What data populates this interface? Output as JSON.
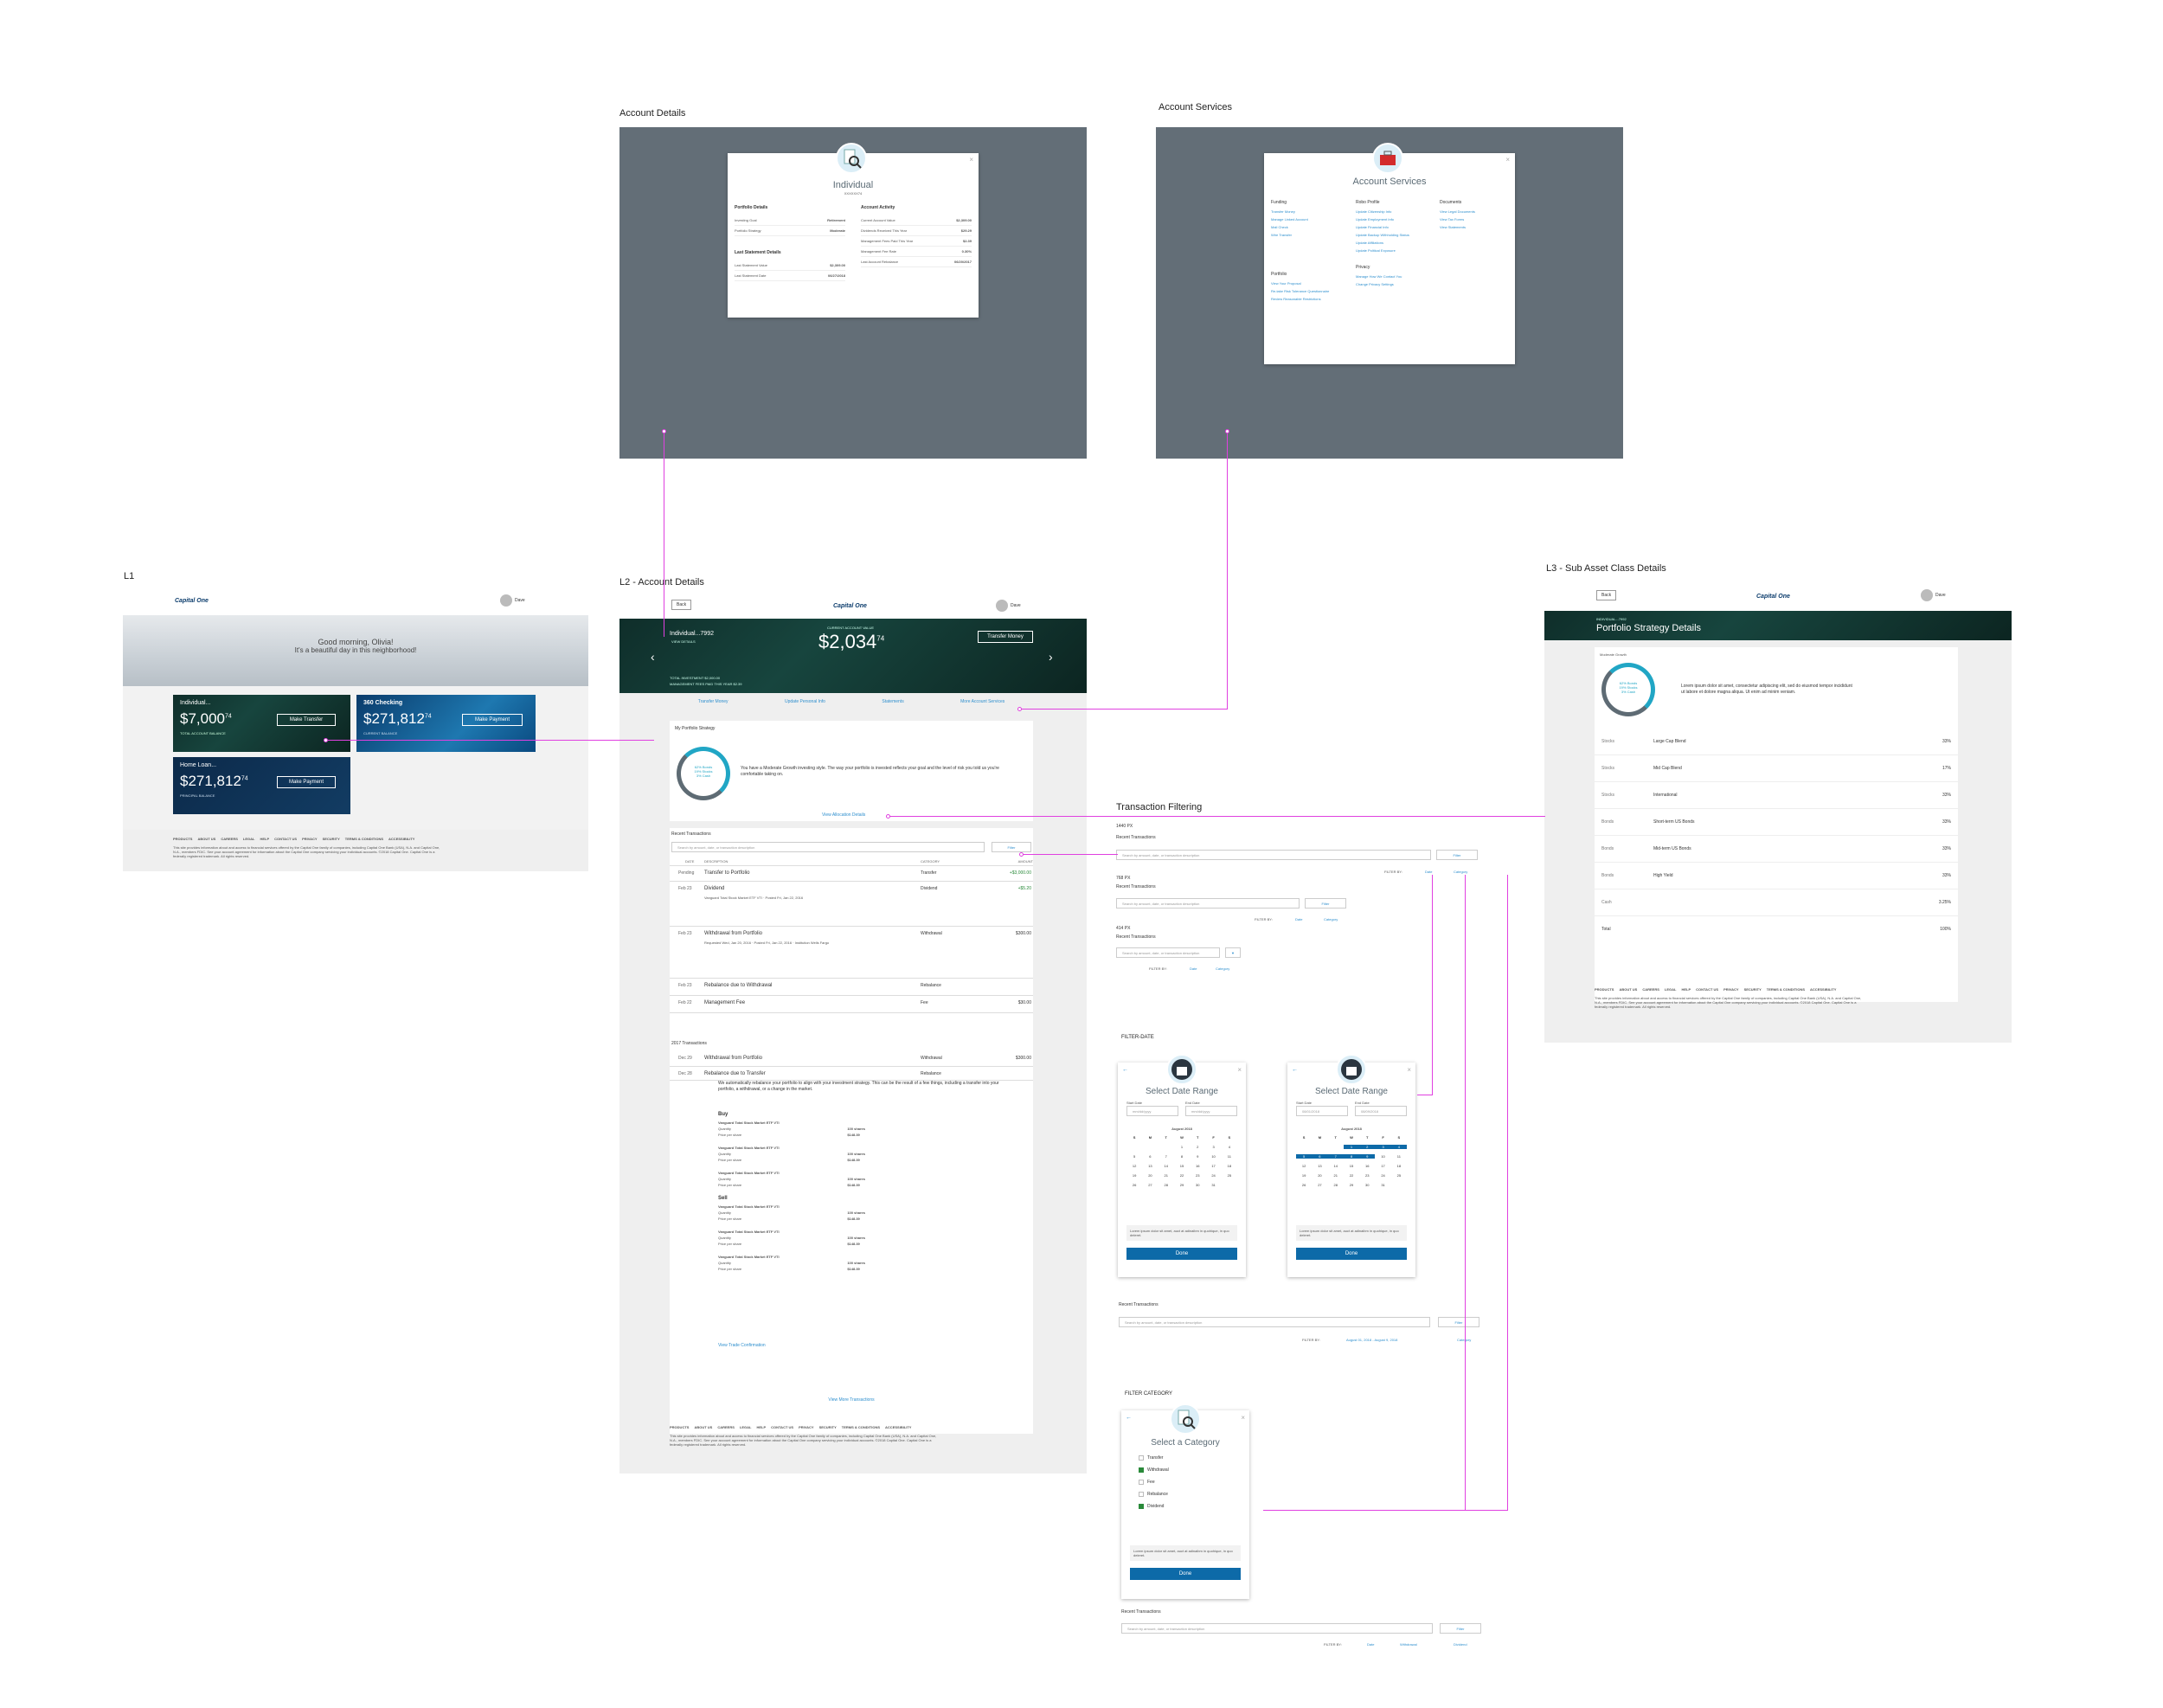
{
  "sections": {
    "account_details": "Account Details",
    "account_services": "Account Services",
    "l1": "L1",
    "l2": "L2 - Account Details",
    "l3": "L3 - Sub Asset Class Details",
    "transaction_filtering": "Transaction Filtering",
    "filter_date": "FILTER-DATE",
    "filter_category": "FILTER CATEGORY"
  },
  "details_modal": {
    "title": "Individual",
    "sub": "XXXXXX74",
    "portfolio_h": "Portfolio Details",
    "portfolio_rows": [
      [
        "Investing Goal",
        "Retirement"
      ],
      [
        "Portfolio Strategy",
        "Moderate"
      ]
    ],
    "statement_h": "Last Statement Details",
    "statement_rows": [
      [
        "Last Statement Value",
        "$2,309.00"
      ],
      [
        "Last Statement Date",
        "06/27/2018"
      ]
    ],
    "activity_h": "Account Activity",
    "activity_rows": [
      [
        "Current Account Value",
        "$2,309.00"
      ],
      [
        "Dividends Received This Year",
        "$29.29"
      ],
      [
        "Management Fees Paid This Year",
        "$2.39"
      ],
      [
        "Management Fee Rate",
        "0.30%"
      ],
      [
        "Last Account Rebalance",
        "06/20/2017"
      ]
    ]
  },
  "services_modal": {
    "title": "Account Services",
    "funding_h": "Funding",
    "funding": [
      "Transfer Money",
      "Manage Linked Account",
      "Mail Check",
      "Wire Transfer"
    ],
    "robo_h": "Robo Profile",
    "robo": [
      "Update Citizenship Info",
      "Update Employment Info",
      "Update Financial Info",
      "Update Backup Withholding Status",
      "Update Affiliations",
      "Update Political Exposure"
    ],
    "docs_h": "Documents",
    "docs": [
      "View Legal Documents",
      "View Tax Forms",
      "View Statements"
    ],
    "portfolio_h": "Portfolio",
    "portfolio": [
      "View Your Proposal",
      "Re-take Risk Tolerance Questionnaire",
      "Review Reasonable Restrictions"
    ],
    "privacy_h": "Privacy",
    "privacy": [
      "Manage How We Contact You",
      "Change Privacy Settings"
    ]
  },
  "header": {
    "logo": "Capital One",
    "user": "Dave",
    "back": "Back"
  },
  "l1": {
    "greeting": "Good morning, Olivia!",
    "subgreeting": "It's a beautiful day in this neighborhood!",
    "cards": [
      {
        "name": "Individual...",
        "sub": "7992",
        "dollars": "$7,000",
        "cents": "74",
        "caption": "TOTAL ACCOUNT BALANCE",
        "action": "Make Transfer"
      },
      {
        "name": "360 Checking",
        "sub": "...7560",
        "dollars": "$271,812",
        "cents": "74",
        "caption": "CURRENT BALANCE",
        "action": "Make Payment"
      },
      {
        "name": "Home Loan...",
        "sub": "9992",
        "dollars": "$271,812",
        "cents": "74",
        "caption": "PRINCIPAL BALANCE",
        "action": "Make Payment"
      }
    ]
  },
  "l2": {
    "acct_name": "Individual...7992",
    "view_details": "VIEW DETAILS",
    "value_label": "CURRENT ACCOUNT VALUE",
    "value": "$2,034",
    "value_cents": "74",
    "transfer": "Transfer Money",
    "total_inv": "TOTAL INVESTMENT  $2,000.00",
    "mgmt_fees": "MANAGEMENT FEES PAID THIS YEAR  $2.39",
    "tabs": [
      "Transfer Money",
      "Update Personal Info",
      "Statements",
      "More Account Services"
    ],
    "strategy_h": "My Portfolio Strategy",
    "donut": [
      "62% Bonds",
      "19% Stocks",
      "3% Cash"
    ],
    "strategy_text": "You have a Moderate Growth investing style. The way your portfolio is invested reflects your goal and the level of risk you told us you're comfortable taking on.",
    "alloc_link": "View Allocation Details",
    "recent_h": "Recent Transactions",
    "search_ph": "Search by amount, date, or transaction description",
    "filter": "Filter",
    "cols": [
      "DATE",
      "DESCRIPTION",
      "CATEGORY",
      "AMOUNT"
    ],
    "tx": [
      {
        "date": "Pending",
        "desc": "Transfer to Portfolio",
        "cat": "Transfer",
        "amt": "+$3,000.00"
      },
      {
        "date": "Feb 23",
        "desc": "Dividend",
        "cat": "Dividend",
        "amt": "+$5.20",
        "detail": "Vanguard Total Stock Market ETF VTI · Posted Fri, Jan 22, 2016"
      },
      {
        "date": "Feb 23",
        "desc": "Withdrawal from Portfolio",
        "cat": "Withdrawal",
        "amt": "$300.00",
        "detail": "Requested Wed, Jan 20, 2016 · Posted Fri, Jan 22, 2016 · Institution Wells Fargo"
      },
      {
        "date": "Feb 23",
        "desc": "Rebalance due to Withdrawal",
        "cat": "Rebalance",
        "amt": ""
      },
      {
        "date": "Feb 22",
        "desc": "Management Fee",
        "cat": "Fee",
        "amt": "$30.00"
      }
    ],
    "tx2017_h": "2017 Transactions",
    "tx2017": [
      {
        "date": "Dec 29",
        "desc": "Withdrawal from Portfolio",
        "cat": "Withdrawal",
        "amt": "$300.00"
      },
      {
        "date": "Dec 28",
        "desc": "Rebalance due to Transfer",
        "cat": "Rebalance",
        "amt": ""
      }
    ],
    "rebalance_note": "We automatically rebalance your portfolio to align with your investment strategy. This can be the result of a few things, including a transfer into your portfolio, a withdrawal, or a change in the market.",
    "buy": "Buy",
    "sell": "Sell",
    "trade_name": "Vanguard Total Stock Market ETF VTI",
    "trade_qty": "Quantity",
    "trade_qty_v": "100 shares",
    "trade_price": "Price per share",
    "trade_price_v": "$148.39",
    "trade_link": "View Trade Confirmation",
    "more": "View More Transactions"
  },
  "footer": {
    "links": [
      "PRODUCTS",
      "ABOUT US",
      "CAREERS",
      "LEGAL",
      "HELP",
      "CONTACT US",
      "PRIVACY",
      "SECURITY",
      "TERMS & CONDITIONS",
      "ACCESSIBILITY"
    ],
    "legal": "This site provides information about and access to financial services offered by the Capital One family of companies, including Capital One Bank (USA), N.A. and Capital One, N.A., members FDIC. See your account agreement for information about the Capital One company servicing your individual accounts. ©2018 Capital One. Capital One is a federally registered trademark. All rights reserved."
  },
  "l3": {
    "crumb": "INDIVIDUAL...7992",
    "title": "Portfolio Strategy Details",
    "style": "Moderate Growth",
    "donut": [
      "62% Bonds",
      "19% Stocks",
      "3% Cash"
    ],
    "lorem": "Lorem ipsum dolor sit amet, consectetur adipiscing elit, sed do eiusmod tempor incididunt ut labore et dolore magna aliqua. Ut enim ad minim veniam.",
    "rows": [
      [
        "Stocks",
        "Large Cap Blend",
        "33%"
      ],
      [
        "Stocks",
        "Mid Cap Blend",
        "17%"
      ],
      [
        "Stocks",
        "International",
        "33%"
      ],
      [
        "Bonds",
        "Short-term US Bonds",
        "33%"
      ],
      [
        "Bonds",
        "Mid-term US Bonds",
        "33%"
      ],
      [
        "Bonds",
        "High Yield",
        "33%"
      ],
      [
        "Cash",
        "",
        "3.25%"
      ]
    ],
    "total": "Total",
    "total_v": "100%"
  },
  "filtering": {
    "w1440": "1440 PX",
    "w768": "768 PX",
    "w414": "414 PX",
    "recent": "Recent Transactions",
    "filter_by": "FILTER BY:",
    "date": "Date",
    "category": "Category",
    "range": "August 01, 2018 - August 9, 2018",
    "withdrawal": "Withdrawal",
    "dividend": "Dividend"
  },
  "date_modal": {
    "title": "Select Date Range",
    "start": "Start Date",
    "end": "End Date",
    "ph": "mm/dd/yyyy",
    "v_start": "08/01/2018",
    "v_end": "08/09/2018",
    "month": "August 2018",
    "days": [
      "S",
      "M",
      "T",
      "W",
      "T",
      "F",
      "S"
    ],
    "nums": [
      "",
      "",
      "",
      "1",
      "2",
      "3",
      "4",
      "5",
      "6",
      "7",
      "8",
      "9",
      "10",
      "11",
      "12",
      "13",
      "14",
      "15",
      "16",
      "17",
      "18",
      "19",
      "20",
      "21",
      "22",
      "23",
      "24",
      "25",
      "26",
      "27",
      "28",
      "29",
      "30",
      "31",
      "",
      ""
    ],
    "note": "Lorem ipsum dolor sit amet, auct at adinaibm in quohique, in quo deleret.",
    "done": "Done"
  },
  "cat_modal": {
    "title": "Select a Category",
    "items": [
      "Transfer",
      "Withdrawal",
      "Fee",
      "Rebalance",
      "Dividend"
    ],
    "checked": [
      false,
      true,
      false,
      false,
      true
    ],
    "note": "Lorem ipsum dolor sit amet, auct at adinaibm in quohique, in quo deleret.",
    "done": "Done"
  },
  "colors": {
    "accent": "#2e8fce",
    "pink": "#e040e0",
    "overlay": "#636e77",
    "button": "#0d6aa8"
  }
}
